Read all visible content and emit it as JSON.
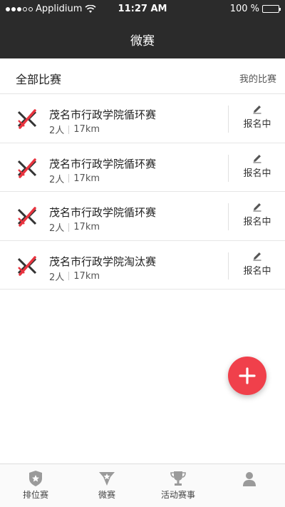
{
  "status_bar": {
    "carrier": "Applidium",
    "time": "11:27 AM",
    "battery": "100 %"
  },
  "nav": {
    "title": "微赛"
  },
  "tabs_header": {
    "all": "全部比赛",
    "mine": "我的比赛"
  },
  "matches": [
    {
      "name": "茂名市行政学院循环赛",
      "people": "2人",
      "distance": "17km",
      "status": "报名中"
    },
    {
      "name": "茂名市行政学院循环赛",
      "people": "2人",
      "distance": "17km",
      "status": "报名中"
    },
    {
      "name": "茂名市行政学院循环赛",
      "people": "2人",
      "distance": "17km",
      "status": "报名中"
    },
    {
      "name": "茂名市行政学院淘汰赛",
      "people": "2人",
      "distance": "17km",
      "status": "报名中"
    }
  ],
  "tab_bar": {
    "items": [
      {
        "label": "排位赛",
        "icon": "shield-icon"
      },
      {
        "label": "微赛",
        "icon": "trophy-cup-icon"
      },
      {
        "label": "活动赛事",
        "icon": "trophy-icon"
      },
      {
        "label": "",
        "icon": "person-icon"
      }
    ]
  },
  "colors": {
    "header_bg": "#2b2b2b",
    "accent_red": "#f0404b",
    "divider": "#e6e6e6"
  }
}
